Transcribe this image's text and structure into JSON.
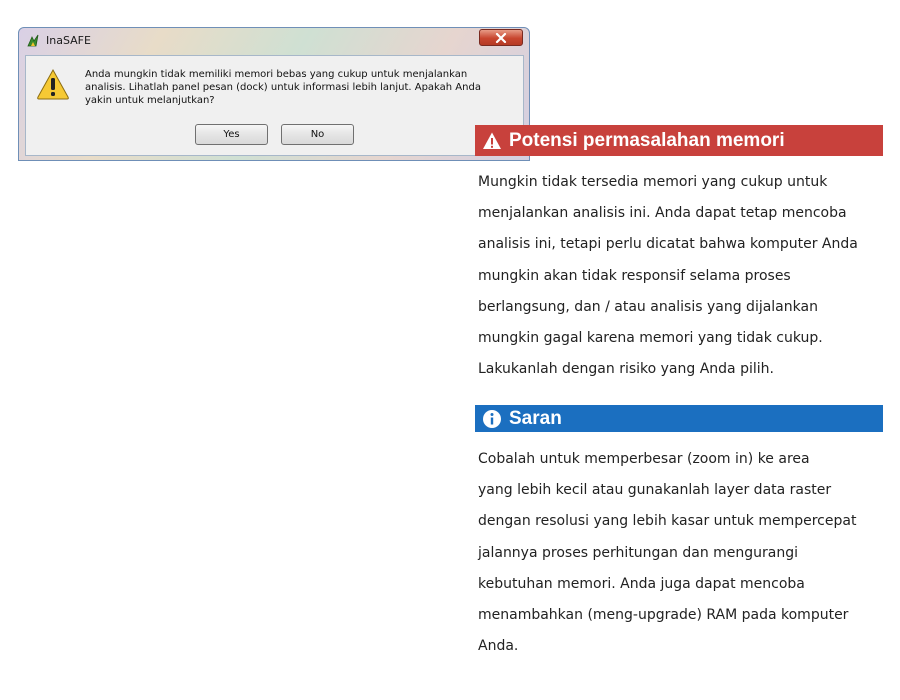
{
  "dialog": {
    "title": "InaSAFE",
    "message": "Anda mungkin tidak memiliki memori bebas yang cukup untuk menjalankan analisis. Lihatlah panel pesan (dock) untuk informasi lebih lanjut. Apakah Anda yakin untuk melanjutkan?",
    "yes_label": "Yes",
    "no_label": "No",
    "close_icon": "close-icon",
    "app_icon": "inasafe-app-icon",
    "warning_icon": "warning-triangle-icon"
  },
  "panel": {
    "warning": {
      "title": "Potensi permasalahan memori",
      "icon": "warning-icon",
      "color": "#c8413c",
      "lines": [
        "Mungkin tidak tersedia memori yang cukup untuk",
        "menjalankan analisis ini. Anda dapat tetap mencoba",
        "analisis ini, tetapi perlu dicatat bahwa komputer Anda",
        "mungkin akan tidak responsif selama proses",
        "berlangsung, dan / atau analisis yang dijalankan",
        "mungkin gagal karena memori yang tidak cukup.",
        "Lakukanlah dengan risiko yang Anda pilih."
      ]
    },
    "suggestion": {
      "title": "Saran",
      "icon": "info-icon",
      "color": "#1b6fc0",
      "lines": [
        "Cobalah untuk memperbesar  (zoom in) ke area",
        "yang lebih kecil atau gunakanlah layer data raster",
        "dengan resolusi yang lebih kasar untuk mempercepat",
        "jalannya proses perhitungan dan mengurangi",
        "kebutuhan memori. Anda juga dapat mencoba",
        "menambahkan (meng-upgrade) RAM pada komputer",
        "Anda."
      ]
    }
  }
}
